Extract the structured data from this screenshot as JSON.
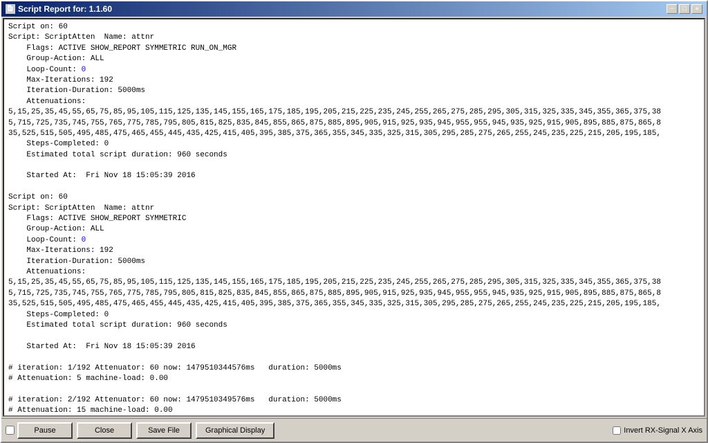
{
  "window": {
    "title": "Script Report for:  1.1.60",
    "min_label": "−",
    "max_label": "□",
    "close_label": "✕"
  },
  "content": {
    "lines": [
      {
        "text": "Script on: 60",
        "blue": false
      },
      {
        "text": "Script: ScriptAtten  Name: attnr",
        "blue": false
      },
      {
        "text": "    Flags: ACTIVE SHOW_REPORT SYMMETRIC RUN_ON_MGR",
        "blue": false
      },
      {
        "text": "    Group-Action: ALL",
        "blue": false
      },
      {
        "text": "    Loop-Count: ",
        "blue": false,
        "blue_part": "0",
        "rest": ""
      },
      {
        "text": "    Max-Iterations: 192",
        "blue": false
      },
      {
        "text": "    Iteration-Duration: 5000ms",
        "blue": false
      },
      {
        "text": "    Attenuations:",
        "blue": false
      },
      {
        "text": "5,15,25,35,45,55,65,75,85,95,105,115,125,135,145,155,165,175,185,195,205,215,225,235,245,255,265,275,285,295,305,315,325,335,345,355,365,375,38",
        "blue": false
      },
      {
        "text": "5,715,725,735,745,755,765,775,785,795,805,815,825,835,845,855,865,875,885,895,905,915,925,935,945,955,955,945,935,925,915,905,895,885,875,865,8",
        "blue": false
      },
      {
        "text": "35,525,515,505,495,485,475,465,455,445,435,425,415,405,395,385,375,365,355,345,335,325,315,305,295,285,275,265,255,245,235,225,215,205,195,185,",
        "blue": false
      },
      {
        "text": "    Steps-Completed: 0",
        "blue": false
      },
      {
        "text": "    Estimated total script duration: 960 seconds",
        "blue": false
      },
      {
        "text": "",
        "blue": false
      },
      {
        "text": "    Started At:  Fri Nov 18 15:05:39 2016",
        "blue": false
      },
      {
        "text": "",
        "blue": false
      },
      {
        "text": "Script on: 60",
        "blue": false
      },
      {
        "text": "Script: ScriptAtten  Name: attnr",
        "blue": false
      },
      {
        "text": "    Flags: ACTIVE SHOW_REPORT SYMMETRIC",
        "blue": false
      },
      {
        "text": "    Group-Action: ALL",
        "blue": false
      },
      {
        "text": "    Loop-Count: ",
        "blue": false,
        "blue_part": "0",
        "rest": ""
      },
      {
        "text": "    Max-Iterations: 192",
        "blue": false
      },
      {
        "text": "    Iteration-Duration: 5000ms",
        "blue": false
      },
      {
        "text": "    Attenuations:",
        "blue": false
      },
      {
        "text": "5,15,25,35,45,55,65,75,85,95,105,115,125,135,145,155,165,175,185,195,205,215,225,235,245,255,265,275,285,295,305,315,325,335,345,355,365,375,38",
        "blue": false
      },
      {
        "text": "5,715,725,735,745,755,765,775,785,795,805,815,825,835,845,855,865,875,885,895,905,915,925,935,945,955,955,945,935,925,915,905,895,885,875,865,8",
        "blue": false
      },
      {
        "text": "35,525,515,505,495,485,475,465,455,445,435,425,415,405,395,385,375,365,355,345,335,325,315,305,295,285,275,265,255,245,235,225,215,205,195,185,",
        "blue": false
      },
      {
        "text": "    Steps-Completed: 0",
        "blue": false
      },
      {
        "text": "    Estimated total script duration: 960 seconds",
        "blue": false
      },
      {
        "text": "",
        "blue": false
      },
      {
        "text": "    Started At:  Fri Nov 18 15:05:39 2016",
        "blue": false
      },
      {
        "text": "",
        "blue": false
      },
      {
        "text": "# iteration: 1/192 Attenuator: 60 now: 1479510344576ms   duration: 5000ms",
        "blue": false
      },
      {
        "text": "# Attenuation: 5 machine-load: 0.00",
        "blue": false
      },
      {
        "text": "",
        "blue": false
      },
      {
        "text": "# iteration: 2/192 Attenuator: 60 now: 1479510349576ms   duration: 5000ms",
        "blue": false
      },
      {
        "text": "# Attenuation: 15 machine-load: 0.00",
        "blue": false
      }
    ]
  },
  "buttons": {
    "pause": "Pause",
    "close": "Close",
    "save_file": "Save File",
    "graphical_display": "Graphical Display",
    "invert_label": "Invert RX-Signal X Axis"
  }
}
